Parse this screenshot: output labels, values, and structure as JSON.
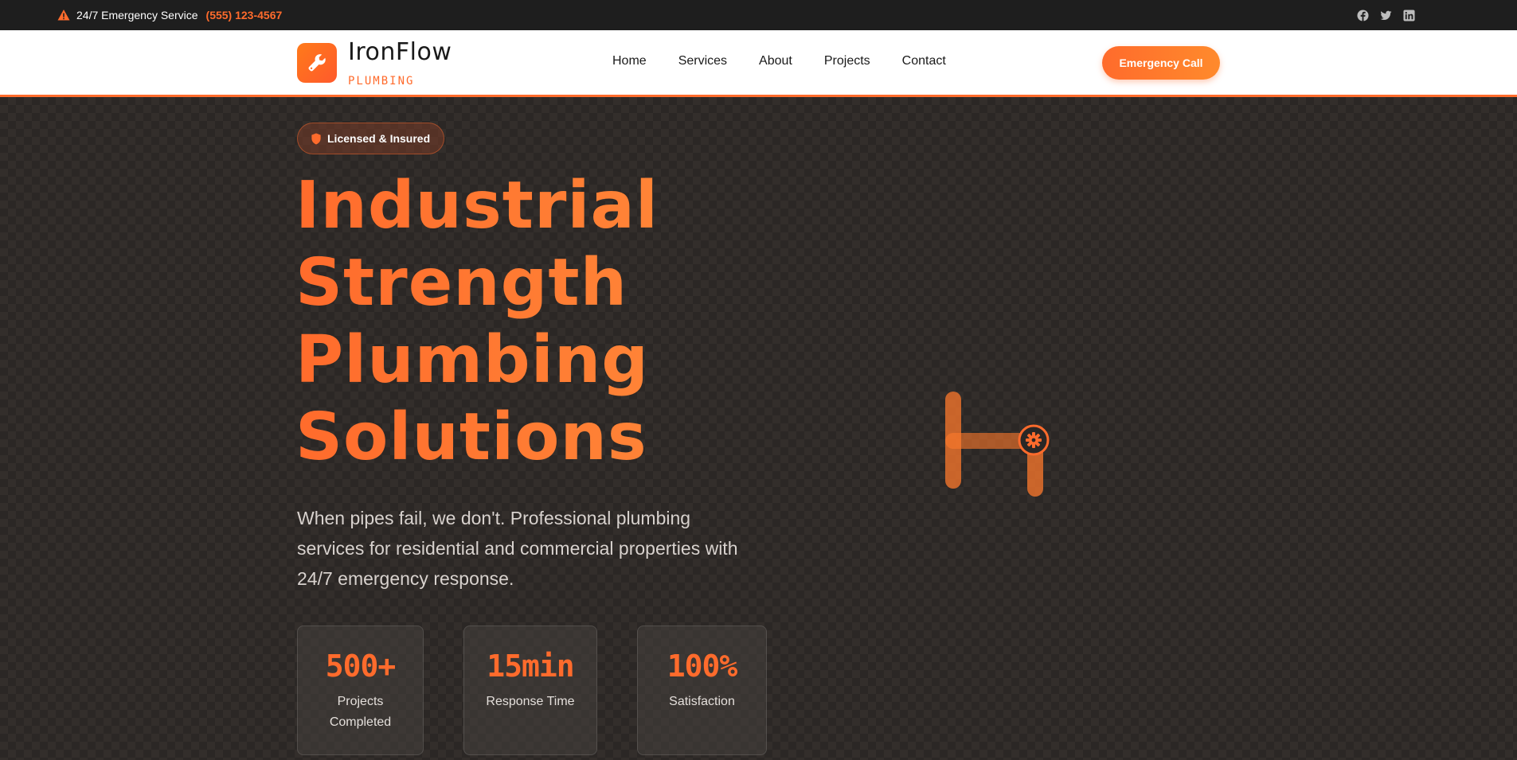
{
  "topbar": {
    "service_text": "24/7 Emergency Service",
    "phone": "(555) 123-4567",
    "alert_icon": "warning-triangle-icon",
    "socials": [
      "facebook-icon",
      "twitter-icon",
      "linkedin-icon"
    ]
  },
  "header": {
    "brand_name": "IronFlow",
    "brand_sub": "PLUMBING",
    "logo_icon": "wrench-icon",
    "nav": [
      {
        "label": "Home"
      },
      {
        "label": "Services"
      },
      {
        "label": "About"
      },
      {
        "label": "Projects"
      },
      {
        "label": "Contact"
      }
    ],
    "cta_label": "Emergency Call"
  },
  "hero": {
    "badge": "Licensed & Insured",
    "headline_lines": [
      "Industrial",
      "Strength",
      "Plumbing",
      "Solutions"
    ],
    "subtext_lines": [
      "When pipes fail, we don't. Professional plumbing",
      "services for residential and commercial properties with",
      "24/7 emergency response."
    ],
    "stats": [
      {
        "value": "500+",
        "label_lines": [
          "Projects",
          "Completed"
        ]
      },
      {
        "value": "15min",
        "label_lines": [
          "Response Time"
        ]
      },
      {
        "value": "100%",
        "label_lines": [
          "Satisfaction"
        ]
      }
    ]
  },
  "colors": {
    "accent": "#ff6b2c",
    "topbar_bg": "#1e1e1e",
    "hero_bg": "#2b2725"
  }
}
